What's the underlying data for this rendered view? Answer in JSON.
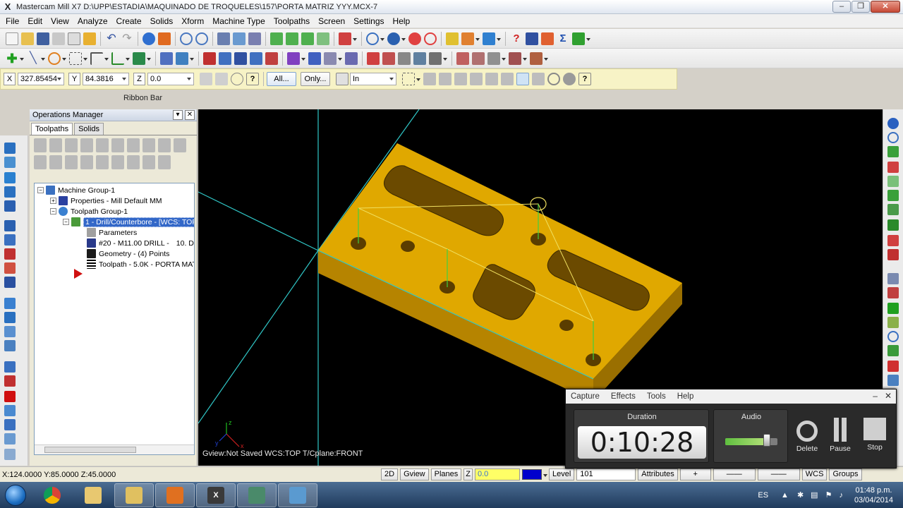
{
  "window": {
    "title": "Mastercam Mill X7  D:\\UPP\\ESTADIA\\MAQUINADO DE TROQUELES\\157\\PORTA MATRIZ YYY.MCX-7"
  },
  "menu": [
    "File",
    "Edit",
    "View",
    "Analyze",
    "Create",
    "Solids",
    "Xform",
    "Machine Type",
    "Toolpaths",
    "Screen",
    "Settings",
    "Help"
  ],
  "ribbon": {
    "x_label": "X",
    "x_value": "327.85454",
    "y_label": "Y",
    "y_value": "84.3816",
    "z_label": "Z",
    "z_value": "0.0",
    "all_label": "All...",
    "only_label": "Only...",
    "plane_value": "In",
    "caption": "Ribbon Bar"
  },
  "ops_manager": {
    "title": "Operations Manager",
    "tabs": [
      "Toolpaths",
      "Solids"
    ],
    "tree": {
      "machine_group": "Machine Group-1",
      "properties": "Properties - Mill Default MM",
      "toolpath_group": "Toolpath Group-1",
      "operation": "1 - Drill/Counterbore - [WCS: TOP",
      "parameters": "Parameters",
      "tool": "#20 - M11.00 DRILL -",
      "tool_extra": "10. D",
      "geometry": "Geometry - (4) Points",
      "toolpath": "Toolpath - 5.0K - PORTA MAT"
    }
  },
  "viewport": {
    "status": "Gview:Not Saved   WCS:TOP   T/Cplane:FRONT",
    "axis_labels": {
      "x": "x",
      "y": "y",
      "z": "z"
    },
    "part_color": "#e0a800"
  },
  "statusbar": {
    "coords": "X:124.0000   Y:85.0000   Z:45.0000",
    "btn_2d": "2D",
    "btn_gview": "Gview",
    "btn_planes": "Planes",
    "z_label": "Z",
    "z_value": "0.0",
    "level_label": "Level",
    "level_value": "101",
    "attributes_label": "Attributes",
    "wcs_label": "WCS",
    "groups_label": "Groups"
  },
  "recorder": {
    "menu": [
      "Capture",
      "Effects",
      "Tools",
      "Help"
    ],
    "duration_label": "Duration",
    "duration_value": "0:10:28",
    "audio_label": "Audio",
    "audio_level": 0.8,
    "delete_label": "Delete",
    "pause_label": "Pause",
    "stop_label": "Stop"
  },
  "taskbar": {
    "language": "ES",
    "time": "01:48 p.m.",
    "date": "03/04/2014"
  }
}
